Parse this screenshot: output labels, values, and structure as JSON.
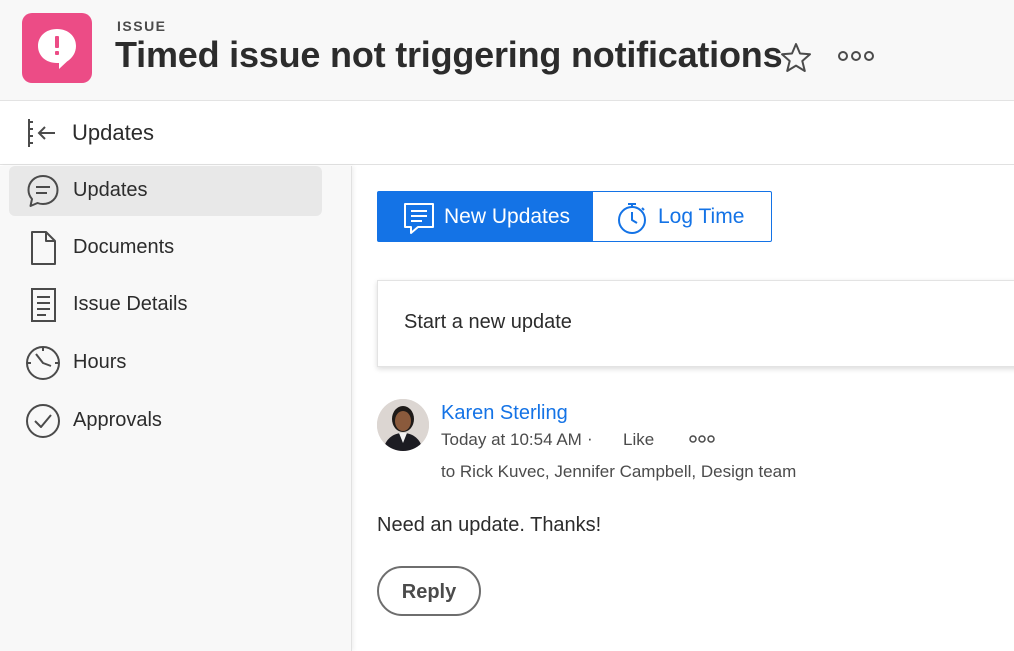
{
  "header": {
    "object_type": "ISSUE",
    "title": "Timed issue not triggering notifications",
    "issue_icon": "issue-exclamation-icon",
    "accent_color": "#ec4c86"
  },
  "section": {
    "title": "Updates"
  },
  "sidebar": {
    "items": [
      {
        "label": "Updates",
        "icon": "comment-icon",
        "active": true
      },
      {
        "label": "Documents",
        "icon": "document-icon",
        "active": false
      },
      {
        "label": "Issue Details",
        "icon": "details-icon",
        "active": false
      },
      {
        "label": "Hours",
        "icon": "clock-icon",
        "active": false
      },
      {
        "label": "Approvals",
        "icon": "checkmark-circle-icon",
        "active": false
      }
    ]
  },
  "tabs": {
    "new_updates": "New Updates",
    "log_time": "Log Time",
    "active_color": "#1473e6"
  },
  "composer": {
    "placeholder": "Start a new update"
  },
  "post": {
    "author": "Karen Sterling",
    "timestamp": "Today at 10:54 AM",
    "separator": "·",
    "like_label": "Like",
    "recipients": "to Rick Kuvec, Jennifer Campbell, Design team",
    "message": "Need an update. Thanks!",
    "reply_label": "Reply"
  }
}
